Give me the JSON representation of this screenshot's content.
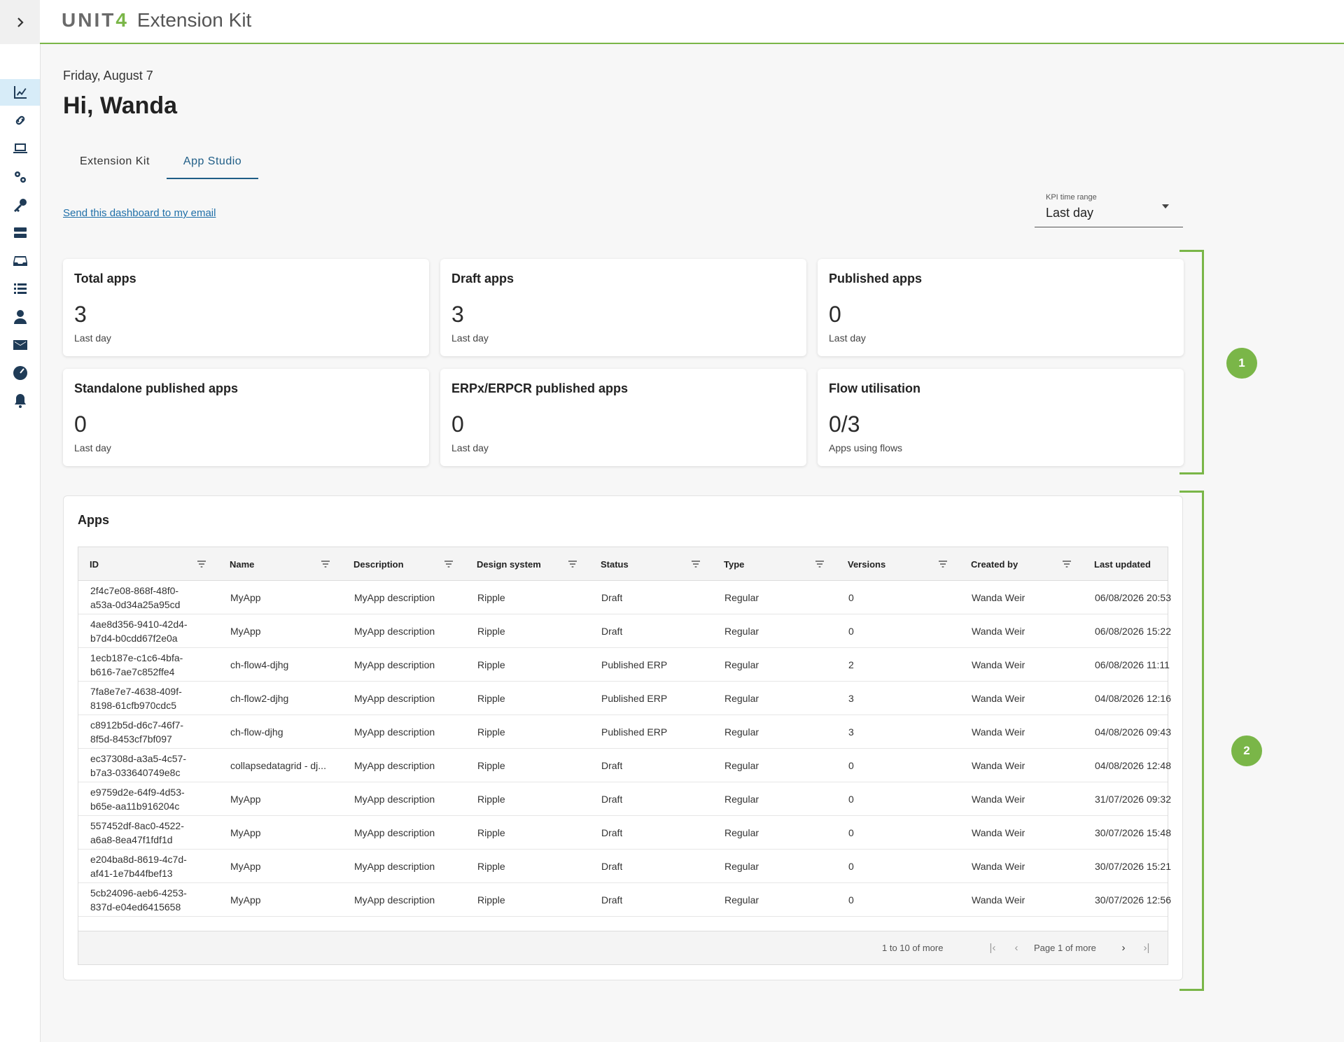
{
  "brand": {
    "logo_prefix": "UNIT",
    "logo_suffix": "4",
    "product": "Extension Kit"
  },
  "header": {
    "date": "Friday, August 7",
    "greeting": "Hi, Wanda"
  },
  "tabs": [
    {
      "label": "Extension Kit",
      "active": false
    },
    {
      "label": "App Studio",
      "active": true
    }
  ],
  "email_link": "Send this dashboard to my email",
  "kpi_range": {
    "label": "KPI time range",
    "value": "Last day"
  },
  "rail_icons": [
    "chart-icon",
    "link-icon",
    "laptop-icon",
    "gears-icon",
    "key-icon",
    "server-icon",
    "inbox-icon",
    "list-icon",
    "user-icon",
    "mail-icon",
    "gauge-icon",
    "bell-icon"
  ],
  "kpis": [
    {
      "title": "Total apps",
      "value": "3",
      "sub": "Last day"
    },
    {
      "title": "Draft apps",
      "value": "3",
      "sub": "Last day"
    },
    {
      "title": "Published apps",
      "value": "0",
      "sub": "Last day"
    },
    {
      "title": "Standalone published apps",
      "value": "0",
      "sub": "Last day"
    },
    {
      "title": "ERPx/ERPCR published apps",
      "value": "0",
      "sub": "Last day"
    },
    {
      "title": "Flow utilisation",
      "value": "0/3",
      "sub": "Apps using flows"
    }
  ],
  "markers": [
    "1",
    "2"
  ],
  "apps": {
    "title": "Apps",
    "columns": [
      "ID",
      "Name",
      "Description",
      "Design system",
      "Status",
      "Type",
      "Versions",
      "Created by",
      "Last updated"
    ],
    "rows": [
      [
        "2f4c7e08-868f-48f0-a53a-0d34a25a95cd",
        "MyApp",
        "MyApp description",
        "Ripple",
        "Draft",
        "Regular",
        "0",
        "Wanda Weir",
        "06/08/2026 20:53"
      ],
      [
        "4ae8d356-9410-42d4-b7d4-b0cdd67f2e0a",
        "MyApp",
        "MyApp description",
        "Ripple",
        "Draft",
        "Regular",
        "0",
        "Wanda Weir",
        "06/08/2026 15:22"
      ],
      [
        "1ecb187e-c1c6-4bfa-b616-7ae7c852ffe4",
        "ch-flow4-djhg",
        "MyApp description",
        "Ripple",
        "Published ERP",
        "Regular",
        "2",
        "Wanda Weir",
        "06/08/2026 11:11"
      ],
      [
        "7fa8e7e7-4638-409f-8198-61cfb970cdc5",
        "ch-flow2-djhg",
        "MyApp description",
        "Ripple",
        "Published ERP",
        "Regular",
        "3",
        "Wanda Weir",
        "04/08/2026 12:16"
      ],
      [
        "c8912b5d-d6c7-46f7-8f5d-8453cf7bf097",
        "ch-flow-djhg",
        "MyApp description",
        "Ripple",
        "Published ERP",
        "Regular",
        "3",
        "Wanda Weir",
        "04/08/2026 09:43"
      ],
      [
        "ec37308d-a3a5-4c57-b7a3-033640749e8c",
        "collapsedatagrid - dj...",
        "MyApp description",
        "Ripple",
        "Draft",
        "Regular",
        "0",
        "Wanda Weir",
        "04/08/2026 12:48"
      ],
      [
        "e9759d2e-64f9-4d53-b65e-aa11b916204c",
        "MyApp",
        "MyApp description",
        "Ripple",
        "Draft",
        "Regular",
        "0",
        "Wanda Weir",
        "31/07/2026 09:32"
      ],
      [
        "557452df-8ac0-4522-a6a8-8ea47f1fdf1d",
        "MyApp",
        "MyApp description",
        "Ripple",
        "Draft",
        "Regular",
        "0",
        "Wanda Weir",
        "30/07/2026 15:48"
      ],
      [
        "e204ba8d-8619-4c7d-af41-1e7b44fbef13",
        "MyApp",
        "MyApp description",
        "Ripple",
        "Draft",
        "Regular",
        "0",
        "Wanda Weir",
        "30/07/2026 15:21"
      ],
      [
        "5cb24096-aeb6-4253-837d-e04ed6415658",
        "MyApp",
        "MyApp description",
        "Ripple",
        "Draft",
        "Regular",
        "0",
        "Wanda Weir",
        "30/07/2026 12:56"
      ]
    ],
    "pagination": {
      "count": "1 to 10 of more",
      "page": "Page 1 of more"
    }
  },
  "colors": {
    "accent": "#7ab648",
    "link": "#1f6fa8",
    "active_tab": "#1f5d86",
    "rail_active": "#d7ecf8"
  }
}
